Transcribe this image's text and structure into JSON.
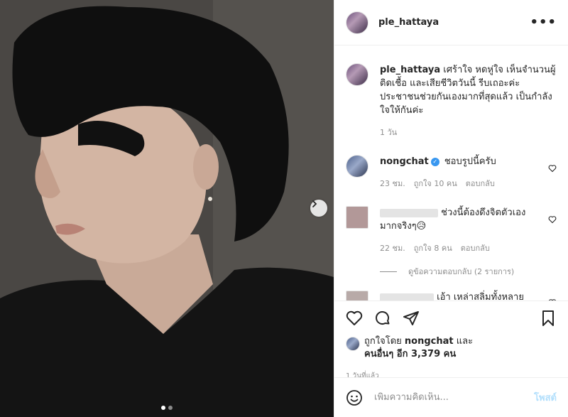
{
  "post": {
    "author": "ple_hattaya",
    "caption": "เศร้าใจ หดหู่ใจ เห็นจำนวนผู้ติดเชื้อ และเสียชีวิตวันนี้ รีบเถอะค่ะ ประชาชนช่วยกันเองมากที่สุดแล้ว เป็นกำลังใจให้กันค่ะ",
    "caption_time": "1 วัน",
    "more_icon": "ellipsis-icon"
  },
  "comments": [
    {
      "user": "nongchat",
      "verified": true,
      "text": "ชอบรูปนี้ครับ",
      "time": "23 ชม.",
      "likes": "ถูกใจ 10 คน",
      "reply": "ตอบกลับ"
    },
    {
      "user": "",
      "text": "ช่วงนี้ต้องดึงจิตตัวเองมากจริงๆ😥",
      "time": "22 ชม.",
      "likes": "ถูกใจ 8 คน",
      "reply": "ตอบกลับ",
      "view_replies": "ดูข้อความตอบกลับ (2 รายการ)"
    },
    {
      "user": "",
      "text": "เอ้า เหล่าสลิ่มทั้งหลาย"
    }
  ],
  "likes": {
    "prefix": "ถูกใจโดย",
    "user": "nongchat",
    "and": "และ",
    "others": "คนอื่นๆ อีก 3,379 คน"
  },
  "posted_time": "1 วันที่แล้ว",
  "add_comment": {
    "placeholder": "เพิ่มความคิดเห็น...",
    "post_label": "โพสต์"
  },
  "colors": {
    "verified": "#3897f0",
    "post_button_disabled": "#b2dffc",
    "muted": "#8e8e8e"
  }
}
